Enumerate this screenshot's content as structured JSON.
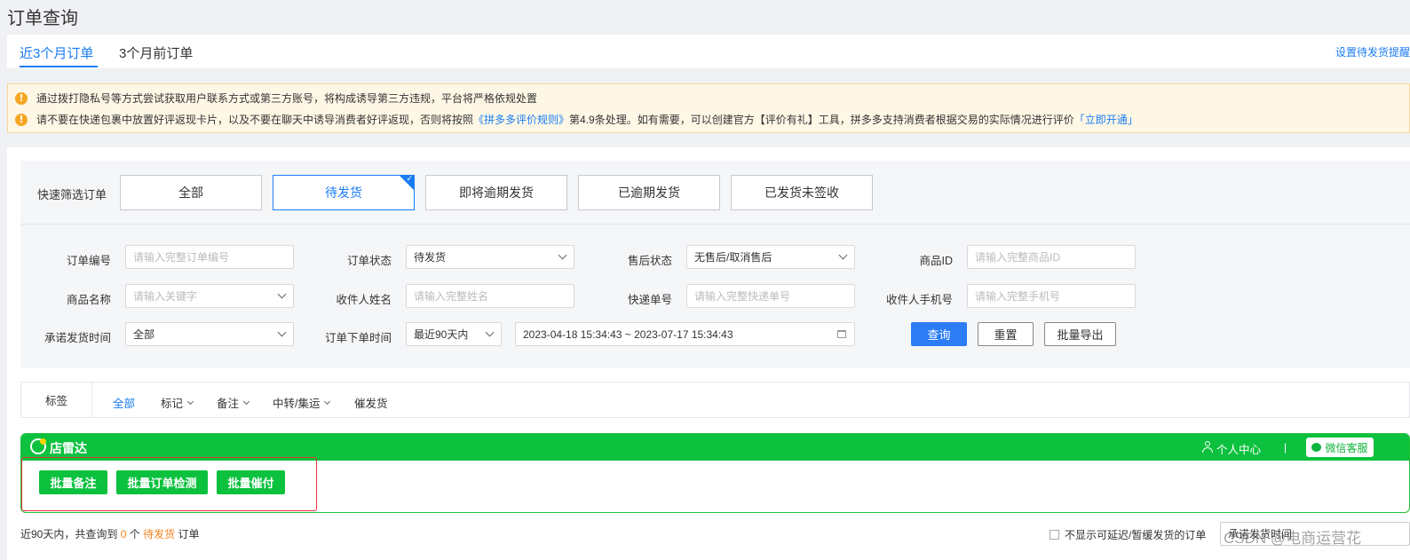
{
  "page_title": "订单查询",
  "tabs": [
    {
      "label": "近3个月订单",
      "active": true
    },
    {
      "label": "3个月前订单",
      "active": false
    }
  ],
  "tab_right_link": "设置待发货提醒",
  "notices": {
    "line1": "通过拨打隐私号等方式尝试获取用户联系方式或第三方账号，将构成诱导第三方违规，平台将严格依规处置",
    "line2_prefix": "请不要在快递包裹中放置好评返现卡片，以及不要在聊天中诱导消费者好评返现，否则将按照",
    "line2_link1": "《拼多多评价规则》",
    "line2_middle": "第4.9条处理。如有需要，可以创建官方【评价有礼】工具，拼多多支持消费者根据交易的实际情况进行评价",
    "line2_link2": "「立即开通」"
  },
  "quick_filter": {
    "label": "快速筛选订单",
    "buttons": [
      "全部",
      "待发货",
      "即将逾期发货",
      "已逾期发货",
      "已发货未签收"
    ],
    "active_index": 1
  },
  "filters": {
    "order_no": {
      "label": "订单编号",
      "placeholder": "请输入完整订单编号"
    },
    "order_status": {
      "label": "订单状态",
      "value": "待发货"
    },
    "after_sale": {
      "label": "售后状态",
      "value": "无售后/取消售后"
    },
    "product_id": {
      "label": "商品ID",
      "placeholder": "请输入完整商品ID"
    },
    "product_name": {
      "label": "商品名称",
      "placeholder": "请输入关键字"
    },
    "receiver_name": {
      "label": "收件人姓名",
      "placeholder": "请输入完整姓名"
    },
    "tracking_no": {
      "label": "快递单号",
      "placeholder": "请输入完整快递单号"
    },
    "receiver_phone": {
      "label": "收件人手机号",
      "placeholder": "请输入完整手机号"
    },
    "promise_time": {
      "label": "承诺发货时间",
      "value": "全部"
    },
    "order_time": {
      "label": "订单下单时间",
      "range_value": "最近90天内",
      "date_range": "2023-04-18 15:34:43 ~ 2023-07-17 15:34:43"
    }
  },
  "actions": {
    "query": "查询",
    "reset": "重置",
    "export": "批量导出"
  },
  "tag_bar": {
    "label": "标签",
    "items": [
      {
        "label": "全部",
        "active": true,
        "dropdown": false
      },
      {
        "label": "标记",
        "active": false,
        "dropdown": true
      },
      {
        "label": "备注",
        "active": false,
        "dropdown": true
      },
      {
        "label": "中转/集运",
        "active": false,
        "dropdown": true
      },
      {
        "label": "催发货",
        "active": false,
        "dropdown": false
      }
    ]
  },
  "plugin": {
    "title": "店雷达",
    "personal_center": "个人中心",
    "separator": "|",
    "wechat_service": "微信客服",
    "buttons": [
      "批量备注",
      "批量订单检测",
      "批量催付"
    ],
    "brand_color": "#0cc13e",
    "highlight_color": "#e8333a"
  },
  "summary": {
    "prefix": "近90天内，共查询到",
    "count": "0",
    "unit": "个",
    "status": "待发货",
    "suffix": "订单"
  },
  "hide_delayed": {
    "label": "不显示可延迟/暂缓发货的订单",
    "checked": false
  },
  "sort_select": {
    "value": "承诺发货时间"
  },
  "watermark": "CSDN @电商运营花"
}
